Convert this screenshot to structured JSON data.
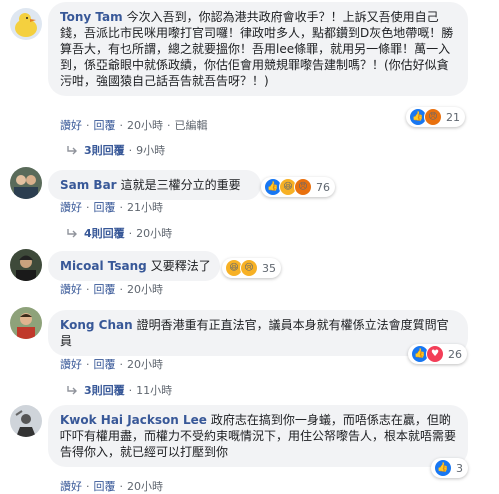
{
  "comments": [
    {
      "name": "Tony Tam",
      "text": "今次入吾到，你認為港共政府會收手？！上訴又吾使用自己錢，吾派比市民咪用嚟打官司囉！律政咁多人，點都鑽到D灰色地帶嘅！勝算吾大，有乜所謂，總之就要搵你！吾用lee條罪，就用另一條罪！萬一入到，係亞爺眼中就係政績，你估佢會用競規罪嚟告建制嗎？！(你估好似貪污咁，強國猿自己話吾告就吾告呀？！)",
      "like": "讚好",
      "reply": "回覆",
      "time": "20小時",
      "edited": "已編輯",
      "reaction_count": "21",
      "reactions": [
        "like-icon",
        "angry-icon"
      ],
      "replies_label": "3則回覆",
      "replies_time": "9小時"
    },
    {
      "name": "Sam Bar",
      "text": "這就是三權分立的重要",
      "like": "讚好",
      "reply": "回覆",
      "time": "21小時",
      "reaction_count": "76",
      "reactions": [
        "like-icon",
        "haha-icon",
        "angry-icon"
      ],
      "replies_label": "4則回覆",
      "replies_time": "20小時"
    },
    {
      "name": "Micoal Tsang",
      "text": "又要釋法了",
      "like": "讚好",
      "reply": "回覆",
      "time": "20小時",
      "reaction_count": "35",
      "reactions": [
        "haha-icon",
        "sad-icon"
      ]
    },
    {
      "name": "Kong Chan",
      "text": "證明香港重有正直法官，議員本身就有權係立法會度質問官員",
      "like": "讚好",
      "reply": "回覆",
      "time": "20小時",
      "reaction_count": "26",
      "reactions": [
        "like-icon",
        "love-icon"
      ],
      "replies_label": "3則回覆",
      "replies_time": "11小時"
    },
    {
      "name": "Kwok Hai Jackson Lee",
      "text": "政府志在搞到你一身蟻，而唔係志在贏，但啲吓吓有權用盡，而權力不受約束嘅情況下，用住公帑嚟告人，根本就唔需要告得你入，就已經可以打壓到你",
      "like": "讚好",
      "reply": "回覆",
      "time": "20小時",
      "reaction_count": "3",
      "reactions": [
        "like-icon"
      ]
    }
  ]
}
